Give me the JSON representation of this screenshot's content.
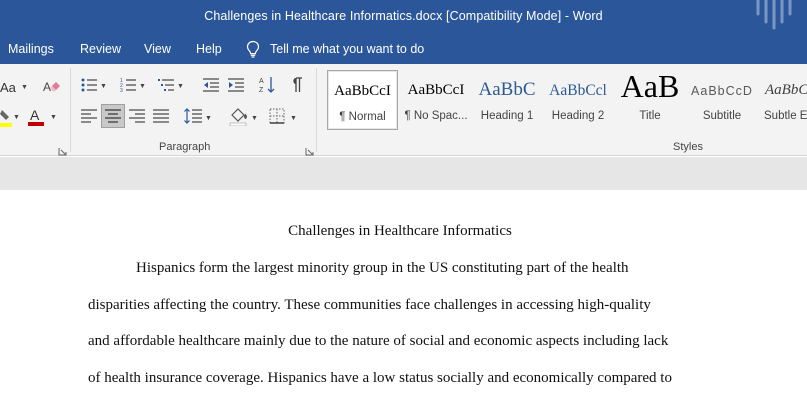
{
  "window": {
    "title": "Challenges in Healthcare Informatics.docx [Compatibility Mode]  -  Word"
  },
  "menu": {
    "tabs": [
      "Mailings",
      "Review",
      "View",
      "Help"
    ],
    "tell_me": "Tell me what you want to do"
  },
  "ribbon": {
    "font_group": {
      "aa_label": "Aa"
    },
    "paragraph_group": {
      "label": "Paragraph"
    },
    "styles_group": {
      "label": "Styles",
      "items": [
        {
          "sample": "AaBbCcI",
          "label": "¶ Normal",
          "selected": true
        },
        {
          "sample": "AaBbCcI",
          "label": "¶ No Spac..."
        },
        {
          "sample": "AaBbC",
          "label": "Heading 1"
        },
        {
          "sample": "AaBbCcl",
          "label": "Heading 2"
        },
        {
          "sample": "AaB",
          "label": "Title"
        },
        {
          "sample": "AaBbCcD",
          "label": "Subtitle"
        },
        {
          "sample": "AaBbC",
          "label": "Subtle E"
        }
      ]
    }
  },
  "colors": {
    "title_bar": "#2b579a",
    "highlight": "#ffff00",
    "font_color": "#c00000"
  },
  "document": {
    "heading": "Challenges in Healthcare Informatics",
    "lines": [
      "Hispanics form the largest minority group in the US constituting part of the health",
      "disparities affecting the country. These communities face challenges in accessing high-quality",
      "and affordable healthcare mainly due to the nature of social and economic aspects including lack",
      "of health insurance coverage. Hispanics have a low status socially and economically compared to"
    ]
  }
}
